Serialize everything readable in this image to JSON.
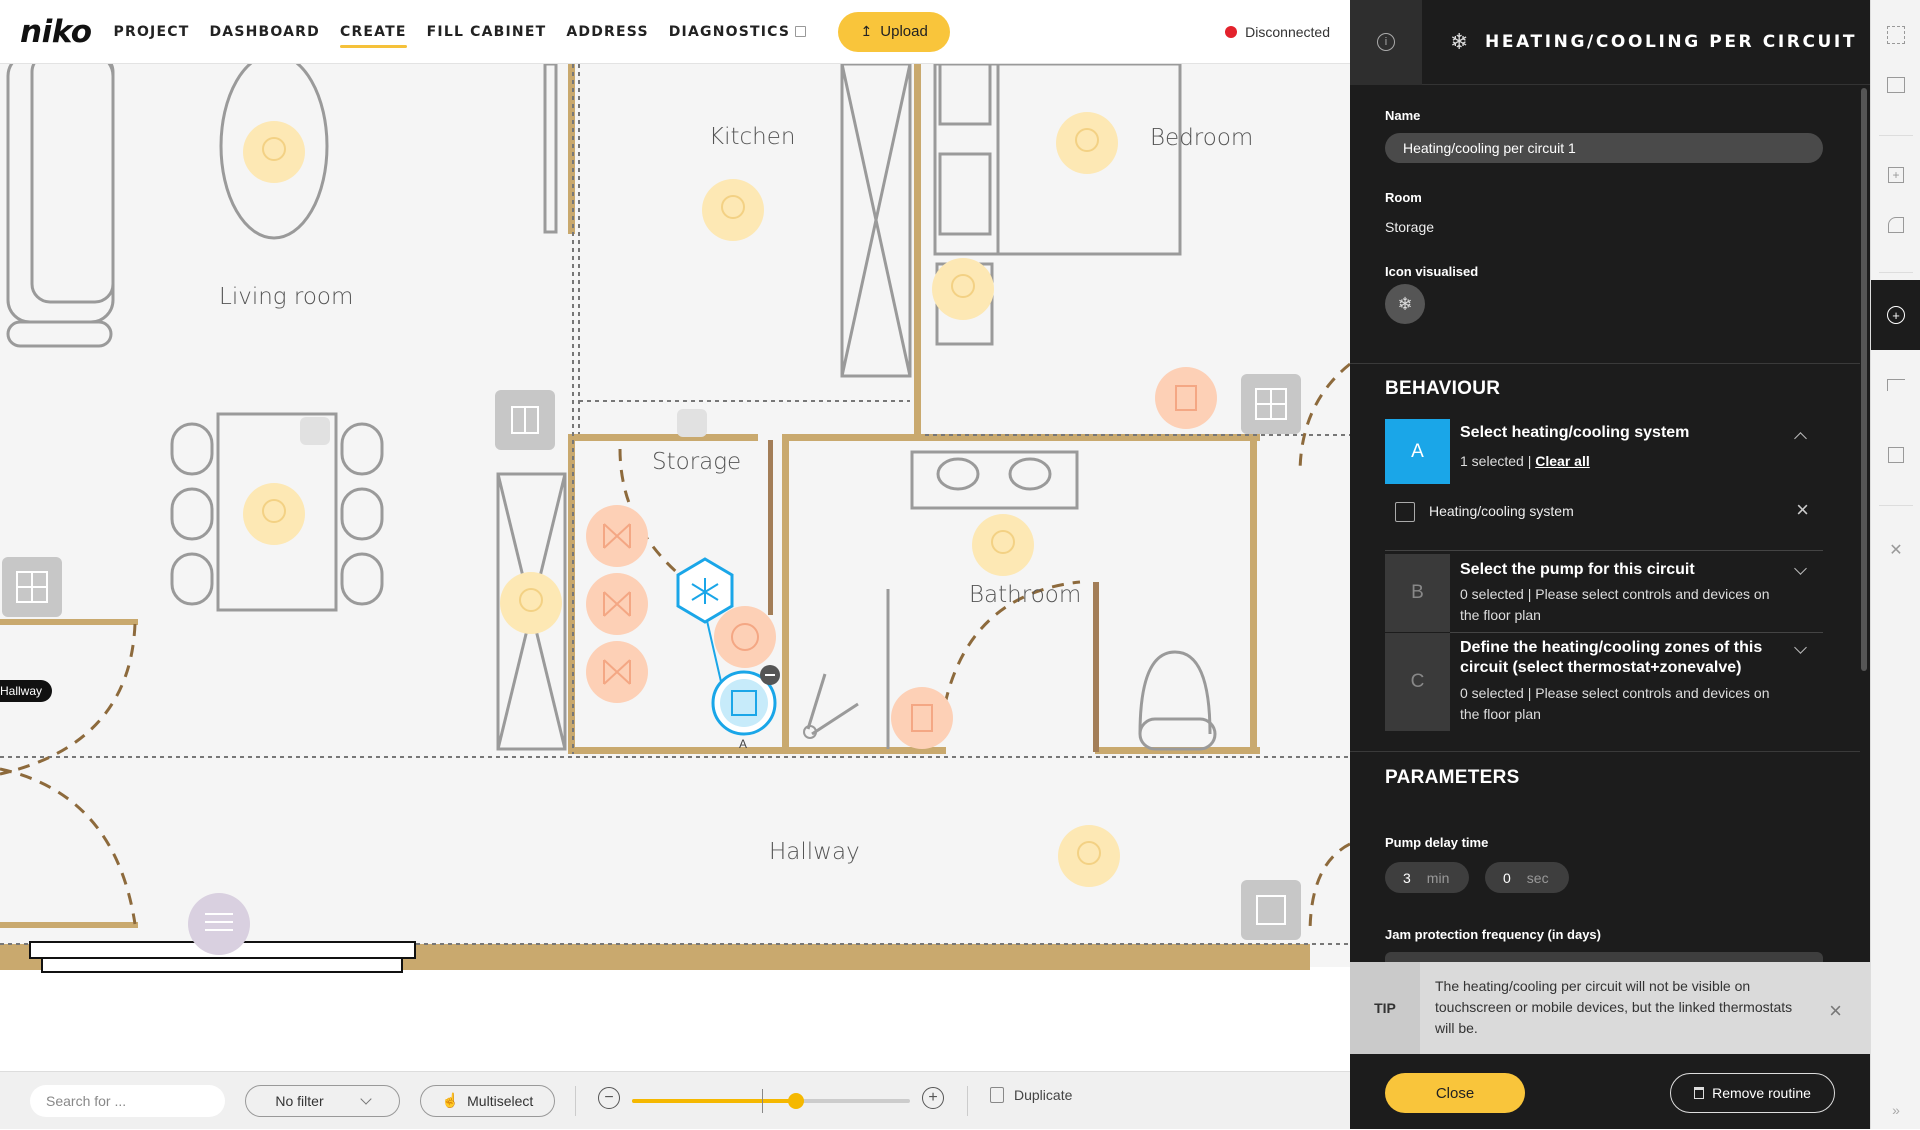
{
  "brand": {
    "logo": "niko",
    "accent": "#f9c53b",
    "selected_blue": "#1aa6e8"
  },
  "topnav": {
    "items": [
      "PROJECT",
      "DASHBOARD",
      "CREATE",
      "FILL CABINET",
      "ADDRESS",
      "DIAGNOSTICS"
    ],
    "active": "CREATE",
    "upload_label": "Upload",
    "status": "Disconnected",
    "status_color": "#e3222c"
  },
  "floorplan": {
    "rooms": [
      "Kitchen",
      "Bedroom",
      "Living room",
      "Storage",
      "Bathroom",
      "Hallway"
    ],
    "hallway_tag": "Hallway",
    "selected_device_tag": "A"
  },
  "toolbar": {
    "search_placeholder": "Search for ...",
    "filter_value": "No filter",
    "multiselect_label": "Multiselect",
    "zoom_level": 0.59,
    "duplicate_label": "Duplicate"
  },
  "panel": {
    "title": "HEATING/COOLING PER CIRCUIT",
    "name_label": "Name",
    "name_value": "Heating/cooling per circuit 1",
    "room_label": "Room",
    "room_value": "Storage",
    "icon_label": "Icon visualised",
    "behaviour_heading": "BEHAVIOUR",
    "behaviour": [
      {
        "letter": "A",
        "title": "Select heating/cooling system",
        "selected": "1 selected | ",
        "clear": "Clear all",
        "item": "Heating/cooling system"
      },
      {
        "letter": "B",
        "title": "Select the pump for this circuit",
        "subtitle": "0 selected | Please select controls and devices on the floor plan"
      },
      {
        "letter": "C",
        "title": "Define the heating/cooling zones of this circuit (select thermostat+zonevalve)",
        "subtitle": "0 selected | Please select controls and devices on the floor plan"
      }
    ],
    "parameters_heading": "PARAMETERS",
    "pump_delay_label": "Pump delay time",
    "pump_delay_min": "3",
    "pump_delay_min_unit": "min",
    "pump_delay_sec": "0",
    "pump_delay_sec_unit": "sec",
    "jam_label": "Jam protection frequency (in days)",
    "tip_label": "TIP",
    "tip_text": "The heating/cooling per circuit will not be visible on touchscreen or mobile devices, but the linked thermostats will be.",
    "close_label": "Close",
    "remove_label": "Remove routine"
  }
}
